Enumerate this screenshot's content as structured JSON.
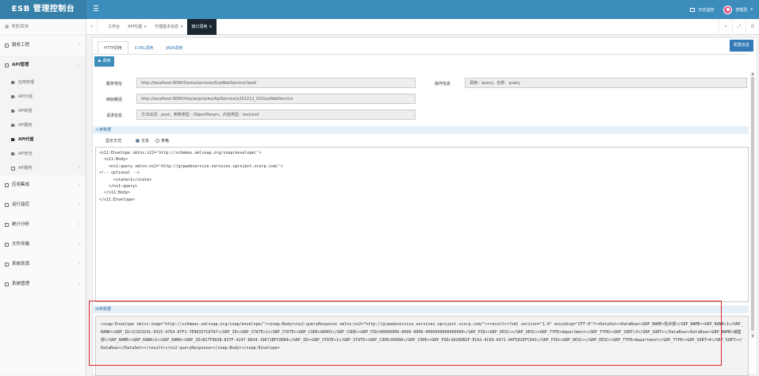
{
  "app": {
    "title": "ESB 管理控制台"
  },
  "topbar": {
    "log_label": "日志监控",
    "user_label": "管理员"
  },
  "sidebar": {
    "header": "导航菜单",
    "groups": [
      {
        "label": "服务工程"
      },
      {
        "label": "API管理"
      },
      {
        "label": "应用集成"
      },
      {
        "label": "运行监控"
      },
      {
        "label": "统计分析"
      },
      {
        "label": "文件传输"
      },
      {
        "label": "系统资源"
      },
      {
        "label": "系统管理"
      }
    ],
    "api_sub": [
      {
        "label": "应用管理"
      },
      {
        "label": "API分组"
      },
      {
        "label": "API标签"
      },
      {
        "label": "API服务"
      },
      {
        "label": "API代理"
      },
      {
        "label": "API安全"
      },
      {
        "label": "API服务"
      }
    ]
  },
  "tabstrip": {
    "tabs": [
      {
        "label": "工作台",
        "closable": false
      },
      {
        "label": "API代理",
        "closable": true
      },
      {
        "label": "代理基本信息",
        "closable": true
      },
      {
        "label": "接口调用",
        "closable": true
      }
    ],
    "close_glyph": "×"
  },
  "content": {
    "subtabs": [
      "HTTP调用",
      "CURL调用",
      "JAVA调用"
    ],
    "config_button": "配置信息",
    "invoke_button": "▶ 调用",
    "form": {
      "service_addr_label": "服务地址",
      "service_addr": "http://localhost:9090/Demo/services/GrpWebService?wsdl",
      "map_path_label": "映射路径",
      "map_path": "http://localhost:9090/http/wsproxies/ApiService/v202212_02/GrpWebService",
      "request_info_label": "请求信息",
      "request_info": "方法动词：post；参数类型：ObjectParam；内容类型：text/xml",
      "op_info_label": "操作信息",
      "op_info": "调用：query；名称：query"
    },
    "input_section": "入参数据",
    "display_mode_label": "显示方式",
    "display_options": [
      "文本",
      "表格"
    ],
    "input_xml": "<s11:Envelope xmlns:s11='http://schemas.xmlsoap.org/soap/envelope/'>\n  <s11:Body>\n    <ns1:query xmlns:ns1='http://grpwebservice.services.xproject.xcorp.com/'>\n<!-- optional -->\n      <state>1</state>\n    </ns1:query>\n  </s11:Body>\n</s11:Envelope>",
    "output_section": "出参数据",
    "output_xml": "<soap:Envelope xmlns:soap=\"http://schemas.xmlsoap.org/soap/envelope/\"><soap:Body><ns2:queryResponse xmlns:ns2=\"http://grpwebservice.services.xproject.xcorp.com/\"><result><?xml version=\"1.0\" encoding=\"UTF-8\"?><DataSet><DataRow><GRP_NAME>技术部</GRP_NAME><GRP_RANK>1</GRP_RANK><GRP_ID>1C023241-9315-4764-A7F1-7E90337C07A7</GRP_ID><GRP_STATE>1</GRP_STATE><GRP_CODE>A0001</GRP_CODE><GRP_PID>00000000-0000-0000-0000000000000000</GRP_PID><GRP_DESC></GRP_DESC><GRP_TYPE>department</GRP_TYPE><GRP_SORT>3</GRP_SORT></DataRow><DataRow><GRP_NAME>销售部</GRP_NAME><GRP_RANK>1</GRP_RANK><GRP_ID>B17F9D2B-837F-4247-8A34-19671BFC0D84</GRP_ID><GRP_STATE>1</GRP_STATE><GRP_CODE>D0006</GRP_CODE><GRP_PID>3A26DB2F-ECA1-4C89-A971-94F501EFCD41</GRP_PID><GRP_DESC></GRP_DESC><GRP_TYPE>department</GRP_TYPE><GRP_SORT>4</GRP_SORT></DataRow></DataSet></result></ns2:queryResponse></soap:Body></soap:Envelope>"
  },
  "colors": {
    "topbar": "#3c8dbc",
    "brand": "#367fa9",
    "accent": "#337ab7",
    "highlight": "#d9262c"
  }
}
